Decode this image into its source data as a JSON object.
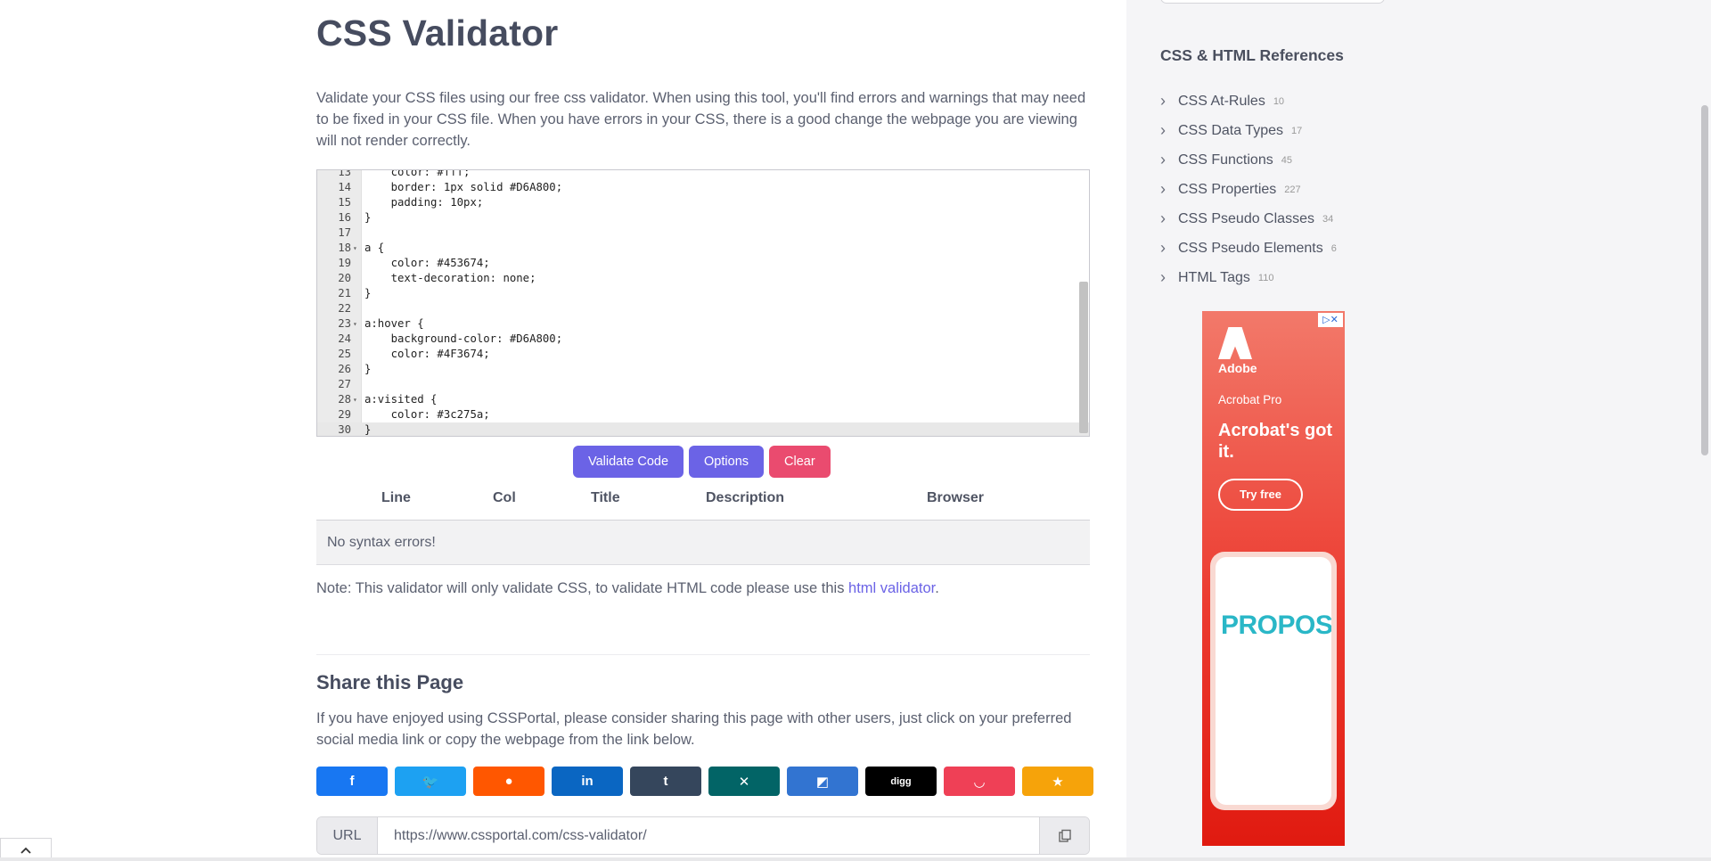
{
  "page": {
    "title": "CSS Validator",
    "intro": "Validate your CSS files using our free css validator. When using this tool, you'll find errors and warnings that may need to be fixed in your CSS file. When you have errors in your CSS, there is a good change the webpage you are viewing will not render correctly."
  },
  "editor": {
    "lines": [
      {
        "n": "13",
        "fold": "",
        "text": "    color: #fff;"
      },
      {
        "n": "14",
        "fold": "",
        "text": "    border: 1px solid #D6A800;"
      },
      {
        "n": "15",
        "fold": "",
        "text": "    padding: 10px;"
      },
      {
        "n": "16",
        "fold": "",
        "text": "}"
      },
      {
        "n": "17",
        "fold": "",
        "text": ""
      },
      {
        "n": "18",
        "fold": "▾",
        "text": "a {"
      },
      {
        "n": "19",
        "fold": "",
        "text": "    color: #453674;"
      },
      {
        "n": "20",
        "fold": "",
        "text": "    text-decoration: none;"
      },
      {
        "n": "21",
        "fold": "",
        "text": "}"
      },
      {
        "n": "22",
        "fold": "",
        "text": ""
      },
      {
        "n": "23",
        "fold": "▾",
        "text": "a:hover {"
      },
      {
        "n": "24",
        "fold": "",
        "text": "    background-color: #D6A800;"
      },
      {
        "n": "25",
        "fold": "",
        "text": "    color: #4F3674;"
      },
      {
        "n": "26",
        "fold": "",
        "text": "}"
      },
      {
        "n": "27",
        "fold": "",
        "text": ""
      },
      {
        "n": "28",
        "fold": "▾",
        "text": "a:visited {"
      },
      {
        "n": "29",
        "fold": "",
        "text": "    color: #3c275a;"
      },
      {
        "n": "30",
        "fold": "",
        "text": "}"
      }
    ]
  },
  "buttons": {
    "validate": "Validate Code",
    "options": "Options",
    "clear": "Clear"
  },
  "results": {
    "headers": [
      "Line",
      "Col",
      "Title",
      "Description",
      "Browser"
    ],
    "empty": "No syntax errors!"
  },
  "note": {
    "before": "Note: This validator will only validate CSS, to validate HTML code please use this ",
    "link": "html validator",
    "after": "."
  },
  "share": {
    "title": "Share this Page",
    "text": "If you have enjoyed using CSSPortal, please consider sharing this page with other users, just click on your preferred social media link or copy the webpage from the link below.",
    "buttons": [
      {
        "name": "facebook",
        "glyph": "f",
        "color": "#1877f2"
      },
      {
        "name": "twitter",
        "glyph": "🐦",
        "color": "#1da1f2"
      },
      {
        "name": "reddit",
        "glyph": "●",
        "color": "#ff5700"
      },
      {
        "name": "linkedin",
        "glyph": "in",
        "color": "#0a66c2"
      },
      {
        "name": "tumblr",
        "glyph": "t",
        "color": "#35465c"
      },
      {
        "name": "xing",
        "glyph": "✕",
        "color": "#026466"
      },
      {
        "name": "delicious",
        "glyph": "◩",
        "color": "#3274d1"
      },
      {
        "name": "digg",
        "glyph": "digg",
        "color": "#000000"
      },
      {
        "name": "pocket",
        "glyph": "◡",
        "color": "#ef4056"
      },
      {
        "name": "favorite",
        "glyph": "★",
        "color": "#f6a30a"
      }
    ],
    "url_label": "URL",
    "url": "https://www.cssportal.com/css-validator/"
  },
  "sidebar": {
    "heading": "CSS & HTML References",
    "items": [
      {
        "label": "CSS At-Rules",
        "count": "10"
      },
      {
        "label": "CSS Data Types",
        "count": "17"
      },
      {
        "label": "CSS Functions",
        "count": "45"
      },
      {
        "label": "CSS Properties",
        "count": "227"
      },
      {
        "label": "CSS Pseudo Classes",
        "count": "34"
      },
      {
        "label": "CSS Pseudo Elements",
        "count": "6"
      },
      {
        "label": "HTML Tags",
        "count": "110"
      }
    ]
  },
  "ad": {
    "brand": "Adobe",
    "product": "Acrobat Pro",
    "headline": "Acrobat's got it.",
    "cta": "Try free",
    "doc_title": "PROPOSAL"
  }
}
